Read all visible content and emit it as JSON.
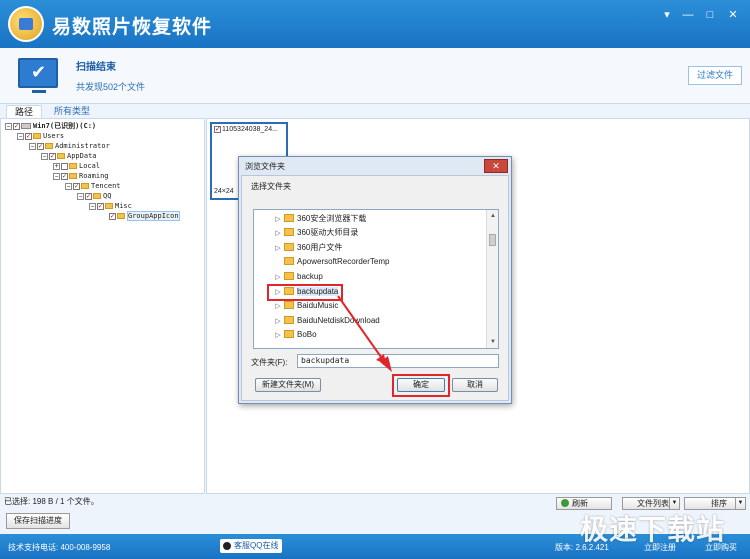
{
  "app": {
    "title": "易数照片恢复软件",
    "window_buttons": [
      "▾",
      "—",
      "□",
      "✕"
    ]
  },
  "scan": {
    "status": "扫描结束",
    "found": "共发现502个文件",
    "filter_button": "过滤文件"
  },
  "tabs": [
    {
      "label": "路径",
      "active": true
    },
    {
      "label": "所有类型",
      "active": false
    }
  ],
  "tree": [
    {
      "label": "Win7(已识别)(C:)",
      "expander": "−",
      "type": "drive"
    },
    {
      "label": "Users",
      "expander": "−",
      "type": "folder"
    },
    {
      "label": "Administrator",
      "expander": "−",
      "type": "folder"
    },
    {
      "label": "AppData",
      "expander": "−",
      "type": "folder"
    },
    {
      "label": "Local",
      "expander": "+",
      "type": "folder"
    },
    {
      "label": "Roaming",
      "expander": "−",
      "type": "folder"
    },
    {
      "label": "Tencent",
      "expander": "−",
      "type": "folder"
    },
    {
      "label": "QQ",
      "expander": "−",
      "type": "folder"
    },
    {
      "label": "Misc",
      "expander": "−",
      "type": "folder"
    },
    {
      "label": "GroupAppIcon",
      "expander": "",
      "type": "folder",
      "selected": true
    }
  ],
  "thumbnail": {
    "name": "1105324038_24...",
    "dimensions": "24×24"
  },
  "dialog": {
    "title": "浏览文件夹",
    "close": "✕",
    "prompt": "选择文件夹",
    "folders": [
      {
        "name": "360安全浏览器下载",
        "arrow": "▷"
      },
      {
        "name": "360驱动大师目录",
        "arrow": "▷"
      },
      {
        "name": "360用户文件",
        "arrow": "▷"
      },
      {
        "name": "ApowersoftRecorderTemp",
        "arrow": ""
      },
      {
        "name": "backup",
        "arrow": "▷"
      },
      {
        "name": "backupdata",
        "arrow": "▷",
        "selected": true
      },
      {
        "name": "BaiduMusic",
        "arrow": "▷"
      },
      {
        "name": "BaiduNetdiskDownload",
        "arrow": "▷"
      },
      {
        "name": "BoBo",
        "arrow": "▷"
      }
    ],
    "folder_label": "文件夹(F):",
    "folder_value": "backupdata",
    "new_folder_button": "新建文件夹(M)",
    "ok_button": "确定",
    "cancel_button": "取消"
  },
  "bottom": {
    "selection_info": "已选择: 198 B / 1 个文件。",
    "save_progress_button": "保存扫描进度",
    "refresh_button": "刷新",
    "file_list_button": "文件列表",
    "sort_button": "排序"
  },
  "footer": {
    "support": "技术支持电话: 400-008-9958",
    "qq": "客服QQ在线",
    "version": "版本: 2.6.2.421",
    "register": "立即注册",
    "buy": "立即购买"
  },
  "watermark": "极速下载站",
  "colors": {
    "accent": "#1a73c4",
    "highlight": "#e0262a"
  }
}
